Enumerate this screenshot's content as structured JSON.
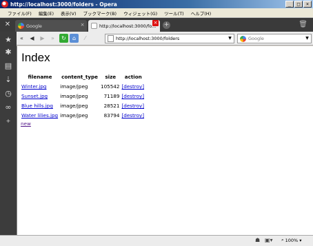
{
  "window": {
    "title": "http://localhost:3000/folders - Opera"
  },
  "menu": [
    "ファイル(F)",
    "編集(E)",
    "表示(V)",
    "ブックマーク(B)",
    "ウィジェット(G)",
    "ツール(T)",
    "ヘルプ(H)"
  ],
  "tabs": [
    {
      "label": "Google",
      "icon": "google-favicon"
    },
    {
      "label": "http://localhost:3000/fo...",
      "icon": "page-favicon",
      "active": true
    }
  ],
  "address": {
    "url": "http://localhost:3000/folders"
  },
  "search": {
    "placeholder": "Google"
  },
  "page": {
    "heading": "Index",
    "columns": [
      "filename",
      "content_type",
      "size",
      "action"
    ],
    "rows": [
      {
        "filename": "Winter.jpg",
        "content_type": "image/jpeg",
        "size": "105542",
        "action": "[destroy]"
      },
      {
        "filename": "Sunset.jpg",
        "content_type": "image/jpeg",
        "size": "71189",
        "action": "[destroy]"
      },
      {
        "filename": "Blue hills.jpg",
        "content_type": "image/jpeg",
        "size": "28521",
        "action": "[destroy]"
      },
      {
        "filename": "Water lilies.jpg",
        "content_type": "image/jpeg",
        "size": "83794",
        "action": "[destroy]"
      }
    ],
    "new_link": "new"
  },
  "status": {
    "zoom": "100%"
  },
  "colors": {
    "link": "#0000cc",
    "visited": "#551a8b",
    "titlebar": "#0a246a",
    "tabbar": "#3a3a3a"
  }
}
